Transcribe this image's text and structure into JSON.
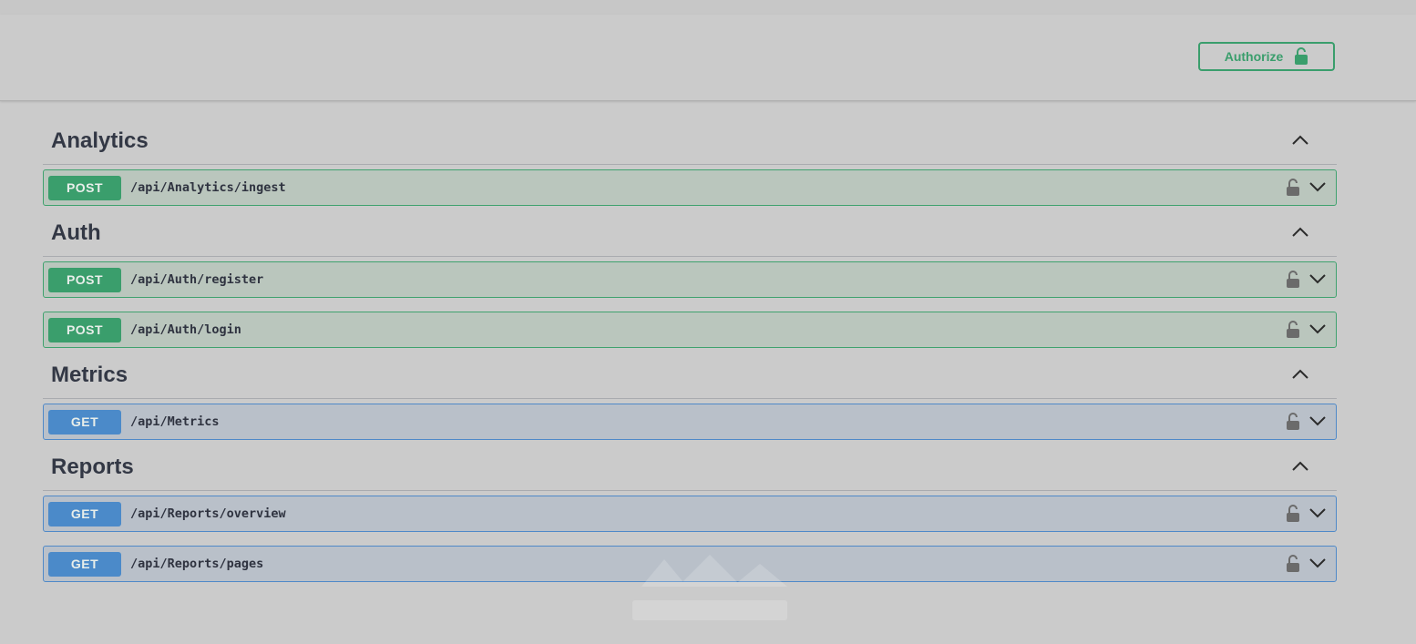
{
  "authorize": {
    "label": "Authorize",
    "icon": "unlocked-lock-icon"
  },
  "colors": {
    "post": "#3a9e6c",
    "get": "#4b8ac9",
    "text": "#333845"
  },
  "sections": [
    {
      "title": "Analytics",
      "operations": [
        {
          "method": "POST",
          "path": "/api/Analytics/ingest"
        }
      ]
    },
    {
      "title": "Auth",
      "operations": [
        {
          "method": "POST",
          "path": "/api/Auth/register"
        },
        {
          "method": "POST",
          "path": "/api/Auth/login"
        }
      ]
    },
    {
      "title": "Metrics",
      "operations": [
        {
          "method": "GET",
          "path": "/api/Metrics"
        }
      ]
    },
    {
      "title": "Reports",
      "operations": [
        {
          "method": "GET",
          "path": "/api/Reports/overview"
        },
        {
          "method": "GET",
          "path": "/api/Reports/pages"
        }
      ]
    }
  ]
}
